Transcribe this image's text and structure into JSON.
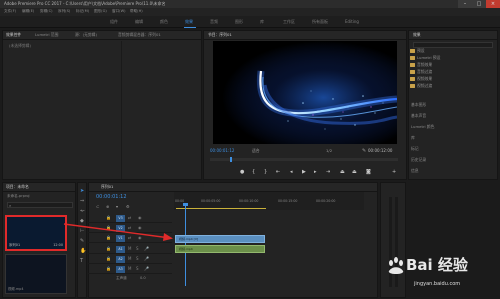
{
  "window": {
    "title": "Adobe Premiere Pro CC 2017 - C:\\Users\\用户\\文档\\Adobe\\Premiere Pro\\11.0\\未命名"
  },
  "menu": [
    "文件(F)",
    "编辑(E)",
    "剪辑(C)",
    "序列(S)",
    "标记(M)",
    "图形(G)",
    "窗口(W)",
    "帮助(H)"
  ],
  "workspaces": [
    "组件",
    "编辑",
    "颜色",
    "效果",
    "音频",
    "图形",
    "库",
    "工作区",
    "所有面板",
    "Editing"
  ],
  "source_panel": {
    "tabs": [
      "效果控件",
      "Lumetri 范围",
      "源：(无剪辑)",
      "音频剪辑混合器：序列01"
    ],
    "note": "(未选择剪辑)"
  },
  "program_panel": {
    "tab": "节目：序列01",
    "timecode_left": "00:00:01:12",
    "fit_label": "适合",
    "quality_label": "1/2",
    "timecode_right": "00:00:12:00"
  },
  "effects_panel": {
    "tab": "效果",
    "items": [
      "预设",
      "Lumetri 预设",
      "音频效果",
      "音频过渡",
      "视频效果",
      "视频过渡"
    ],
    "lower_tabs": [
      "基本图形",
      "基本声音",
      "Lumetri 颜色",
      "库",
      "标记",
      "历史记录",
      "信息"
    ]
  },
  "project_panel": {
    "tab": "项目：未命名",
    "file": "未命名.prproj",
    "clip1_name": "序列01",
    "clip1_duration": "12:00",
    "clip2_name": "视频.mp4"
  },
  "timeline": {
    "tab": "序列01",
    "timecode": "00:00:01:12",
    "ruler_labels": [
      "00:00",
      "00:00:05:00",
      "00:00:10:00",
      "00:00:15:00",
      "00:00:20:00"
    ],
    "tracks": [
      "V3",
      "V2",
      "V1",
      "A1",
      "A2",
      "A3"
    ],
    "master_label": "主声道",
    "master_value": "0.0",
    "clip_v": "视频.mp4 [V]",
    "clip_a": "视频.mp4"
  },
  "watermark": {
    "brand": "Bai 经验",
    "url": "jingyan.baidu.com"
  }
}
